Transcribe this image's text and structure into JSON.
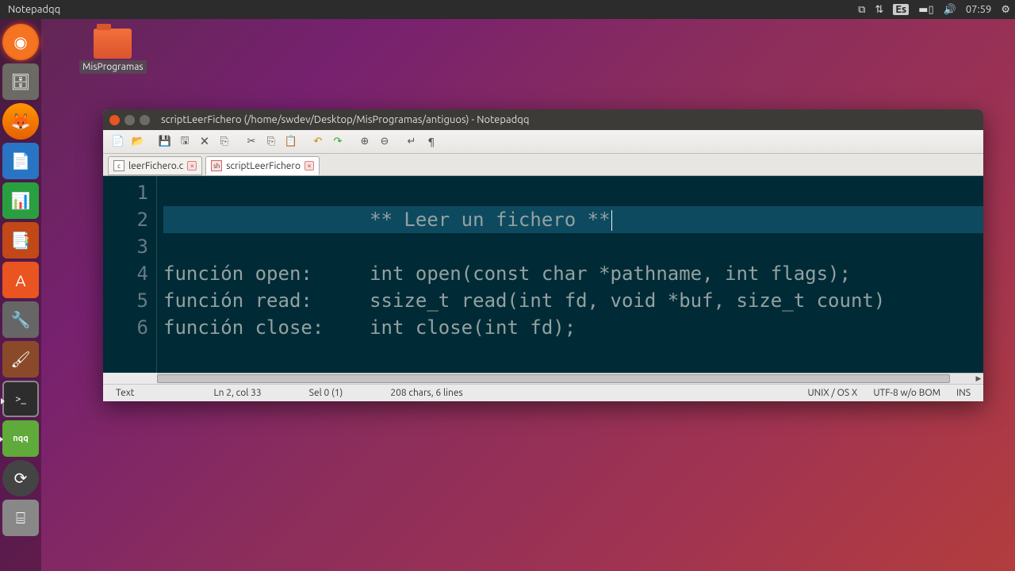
{
  "topbar": {
    "app": "Notepadqq",
    "lang": "Es",
    "time": "07:59"
  },
  "desktop": {
    "folder_label": "MisProgramas"
  },
  "launcher": {
    "items": [
      {
        "name": "dash",
        "glyph": "◉"
      },
      {
        "name": "files",
        "glyph": "🗄"
      },
      {
        "name": "firefox",
        "glyph": "🦊"
      },
      {
        "name": "writer",
        "glyph": "📄"
      },
      {
        "name": "calc",
        "glyph": "📊"
      },
      {
        "name": "impress",
        "glyph": "📑"
      },
      {
        "name": "software",
        "glyph": "A"
      },
      {
        "name": "settings",
        "glyph": "🔧"
      },
      {
        "name": "brush",
        "glyph": "🖌"
      },
      {
        "name": "terminal",
        "glyph": ">_"
      },
      {
        "name": "nqq",
        "glyph": "nqq"
      },
      {
        "name": "updater",
        "glyph": "⟳"
      },
      {
        "name": "drive",
        "glyph": "⌸"
      }
    ]
  },
  "window": {
    "title": "scriptLeerFichero (/home/swdev/Desktop/MisProgramas/antiguos) - Notepadqq"
  },
  "tabs": [
    {
      "label": "leerFichero.c",
      "active": false
    },
    {
      "label": "scriptLeerFichero",
      "active": true
    }
  ],
  "editor": {
    "lines": [
      "",
      "                  ** Leer un fichero **",
      "",
      "función open:     int open(const char *pathname, int flags);",
      "función read:     ssize_t read(int fd, void *buf, size_t count)",
      "función close:    int close(int fd);"
    ],
    "highlighted_line": 2
  },
  "status": {
    "lang": "Text",
    "pos": "Ln 2, col 33",
    "sel": "Sel 0 (1)",
    "chars": "208 chars, 6 lines",
    "eol": "UNIX / OS X",
    "enc": "UTF-8 w/o BOM",
    "mode": "INS"
  }
}
